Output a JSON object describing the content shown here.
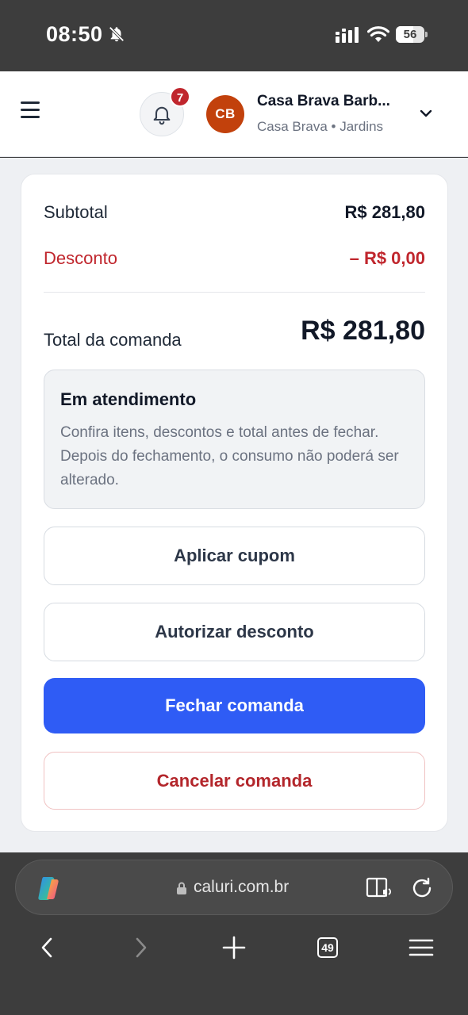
{
  "status_bar": {
    "time": "08:50",
    "battery": "56",
    "icons": [
      "bell-slash-icon",
      "signal-icon",
      "wifi-icon",
      "battery-icon"
    ]
  },
  "header": {
    "notification_count": "7",
    "avatar_initials": "CB",
    "business_name": "Casa Brava Barb...",
    "business_sub": "Casa Brava • Jardins",
    "avatar_color": "#c2410c"
  },
  "summary": {
    "subtotal_label": "Subtotal",
    "subtotal_value": "R$ 281,80",
    "discount_label": "Desconto",
    "discount_value": "– R$ 0,00",
    "total_label": "Total da comanda",
    "total_value": "R$ 281,80"
  },
  "status": {
    "title": "Em atendimento",
    "text": "Confira itens, descontos e total antes de fechar. Depois do fechamento, o consumo não poderá ser alterado."
  },
  "actions": {
    "coupon_label": "Aplicar cupom",
    "discount_label": "Autorizar desconto",
    "close_label": "Fechar comanda",
    "cancel_label": "Cancelar comanda"
  },
  "browser": {
    "url": "caluri.com.br",
    "tab_count": "49"
  },
  "colors": {
    "primary": "#2f5cf5",
    "danger": "#c0262d"
  }
}
